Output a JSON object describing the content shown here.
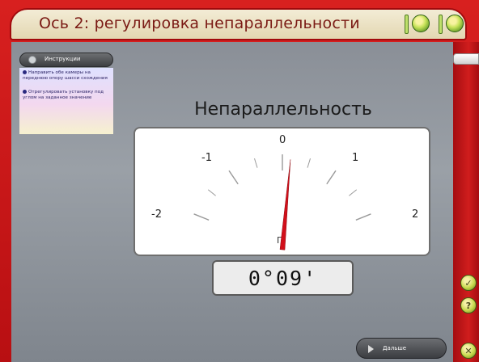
{
  "window": {
    "title": "Ось 2: регулировка непараллельности"
  },
  "status_indicators": [
    {
      "icon": "status-bar-indicator",
      "color": "#c8e35a"
    },
    {
      "icon": "status-light",
      "color": "#c8e35a"
    },
    {
      "icon": "status-bar-indicator",
      "color": "#c8e35a"
    },
    {
      "icon": "status-light",
      "color": "#c8e35a"
    }
  ],
  "instructions": {
    "button_label": "Инструкции",
    "steps": [
      "Направить обе камеры на переднюю опору шасси схождения",
      "Отрегулировать установку под углом на заданное значение"
    ]
  },
  "gauge": {
    "title": "Непараллельность",
    "scale_labels": [
      "-2",
      "-1",
      "0",
      "1",
      "2"
    ],
    "scale_min": -2,
    "scale_max": 2,
    "needle_value": 0.15,
    "unit_mark": "Г",
    "needle_color": "#d20f1a"
  },
  "readout": {
    "value": "0°09'"
  },
  "footer": {
    "next_label": "Дальше"
  },
  "side_buttons": [
    {
      "icon": "check-icon",
      "symbol": "✓"
    },
    {
      "icon": "help-icon",
      "symbol": "?"
    },
    {
      "icon": "close-icon",
      "symbol": "✕"
    }
  ]
}
